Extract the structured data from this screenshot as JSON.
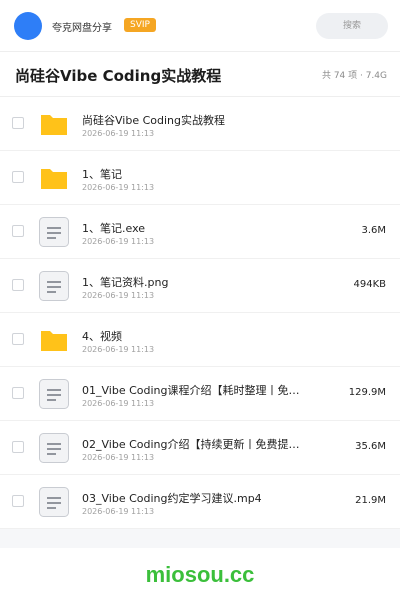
{
  "topbar": {
    "brand": "夸克网盘分享",
    "vip_badge": "SVIP",
    "search_placeholder": "搜索"
  },
  "header": {
    "title": "尚硅谷Vibe Coding实战教程",
    "summary": "共 74 项 · 7.4G"
  },
  "files": [
    {
      "icon": "folder-icon",
      "name": "尚硅谷Vibe Coding实战教程",
      "date": "2026-06-19 11:13",
      "size": ""
    },
    {
      "icon": "folder-icon",
      "name": "1、笔记",
      "date": "2026-06-19 11:13",
      "size": ""
    },
    {
      "icon": "file-icon",
      "name": "1、笔记.exe",
      "date": "2026-06-19 11:13",
      "size": "3.6M"
    },
    {
      "icon": "file-icon",
      "name": "1、笔记资料.png",
      "date": "2026-06-19 11:13",
      "size": "494KB"
    },
    {
      "icon": "folder-icon",
      "name": "4、视频",
      "date": "2026-06-19 11:13",
      "size": ""
    },
    {
      "icon": "file-icon",
      "name": "01_Vibe Coding课程介绍【耗时整理丨免…",
      "date": "2026-06-19 11:13",
      "size": "129.9M"
    },
    {
      "icon": "file-icon",
      "name": "02_Vibe Coding介绍【持续更新丨免费提…",
      "date": "2026-06-19 11:13",
      "size": "35.6M"
    },
    {
      "icon": "file-icon",
      "name": "03_Vibe Coding约定学习建议.mp4",
      "date": "2026-06-19 11:13",
      "size": "21.9M"
    }
  ],
  "watermark": "miosou.cc",
  "colors": {
    "avatar": "#2e7ef7",
    "vip": "#f5a623",
    "folder": "#ffc21a",
    "watermark": "#3bbf3b"
  }
}
